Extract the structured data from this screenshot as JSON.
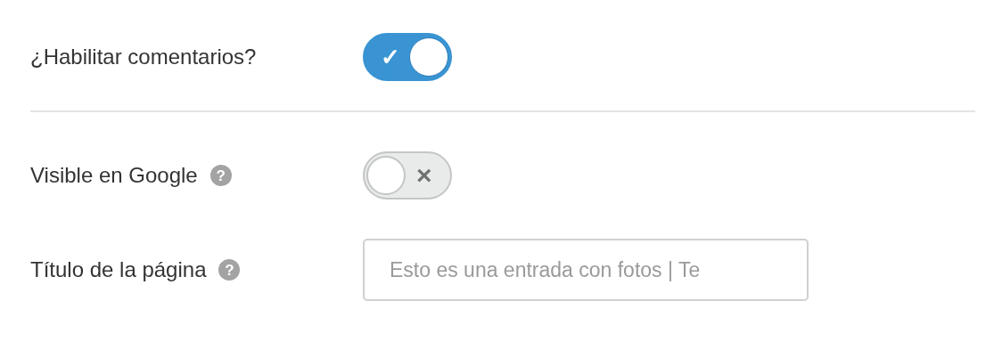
{
  "settings": [
    {
      "kind": "toggle",
      "label": "¿Habilitar comentarios?",
      "on": true,
      "glyph": "✓"
    },
    {
      "kind": "toggle",
      "label": "Visible en Google",
      "help": "?",
      "on": false,
      "glyph": "×"
    },
    {
      "kind": "text_field",
      "label": "Título de la página",
      "help": "?",
      "placeholder": "Esto es una entrada con fotos | Te"
    }
  ]
}
